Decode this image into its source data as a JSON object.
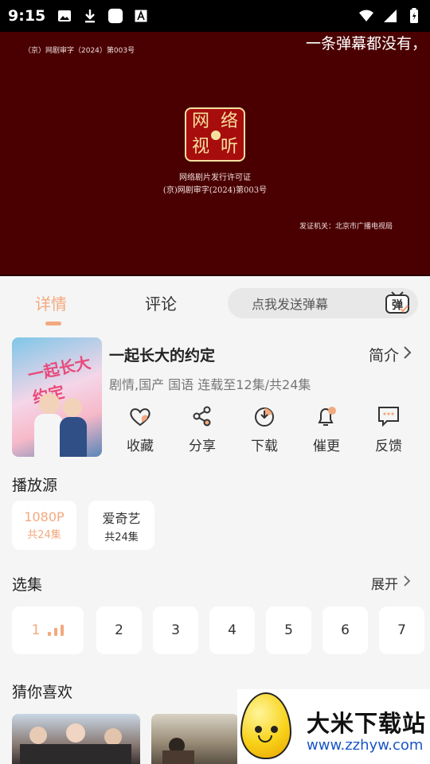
{
  "status_bar": {
    "time": "9:15",
    "left_icons": [
      "image-icon",
      "download-icon",
      "square-app-icon",
      "font-a-icon"
    ],
    "right_icons": [
      "wifi-icon",
      "signal-icon",
      "battery-icon"
    ]
  },
  "player": {
    "license_top": "（京）网剧审字（2024）第003号",
    "danmaku_text": "一条弹幕都没有，",
    "seal_chars": [
      "网",
      "络",
      "视",
      "听"
    ],
    "license_line1": "网络剧片发行许可证",
    "license_line2": "(京)网剧审字(2024)第003号",
    "issuer": "发证机关：北京市广播电视局"
  },
  "tabs": {
    "details": "详情",
    "comments": "评论",
    "danmaku_placeholder": "点我发送弹幕",
    "danmaku_button_char": "弹"
  },
  "show": {
    "poster_title": "一起长大约定",
    "title": "一起长大的约定",
    "intro_label": "简介",
    "meta": "剧情,国产 国语 连载至12集/共24集",
    "actions": [
      {
        "icon": "heart-icon",
        "label": "收藏"
      },
      {
        "icon": "share-icon",
        "label": "分享"
      },
      {
        "icon": "download-icon",
        "label": "下载"
      },
      {
        "icon": "bell-icon",
        "label": "催更"
      },
      {
        "icon": "feedback-icon",
        "label": "反馈"
      }
    ]
  },
  "sources": {
    "title": "播放源",
    "items": [
      {
        "name": "1080P",
        "count": "共24集",
        "selected": true
      },
      {
        "name": "爱奇艺",
        "count": "共24集",
        "selected": false
      }
    ]
  },
  "episodes": {
    "title": "选集",
    "expand_label": "展开",
    "items": [
      "1",
      "2",
      "3",
      "4",
      "5",
      "6",
      "7"
    ],
    "current": "1"
  },
  "recommend": {
    "title": "猜你喜欢"
  },
  "watermark": {
    "site_name": "大米下载站",
    "url": "www.zzhyw.com"
  },
  "colors": {
    "accent": "#f2a97e",
    "player_bg": "#4a0000",
    "page_bg": "#f5f5f5"
  }
}
